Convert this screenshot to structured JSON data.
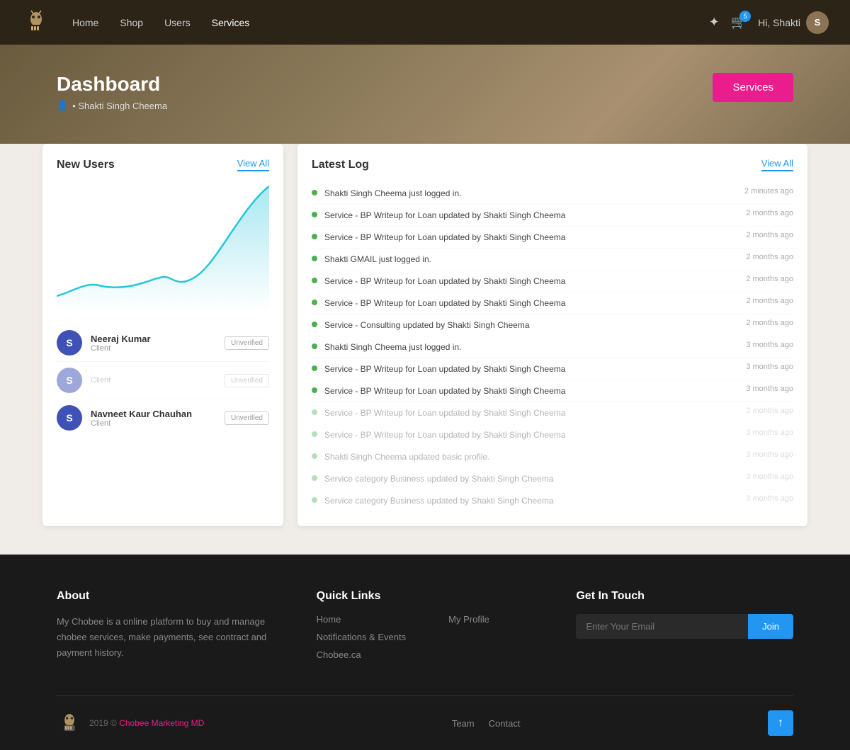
{
  "nav": {
    "links": [
      {
        "label": "Home",
        "active": false
      },
      {
        "label": "Shop",
        "active": false
      },
      {
        "label": "Users",
        "active": false
      },
      {
        "label": "Services",
        "active": true
      }
    ],
    "cart_badge": "5",
    "user_greeting": "Hi, Shakti",
    "avatar_letter": "S"
  },
  "hero": {
    "title": "Dashboard",
    "user": "• Shakti Singh Cheema",
    "services_button": "Services"
  },
  "new_users": {
    "title": "New Users",
    "view_all": "View All",
    "users": [
      {
        "initial": "S",
        "name": "Neeraj Kumar",
        "role": "Client",
        "badge": "Unverified"
      },
      {
        "initial": "S",
        "name": "",
        "role": "Client",
        "badge": "Unverified"
      },
      {
        "initial": "S",
        "name": "Navneet Kaur Chauhan",
        "role": "Client",
        "badge": "Unverified"
      }
    ]
  },
  "latest_log": {
    "title": "Latest Log",
    "view_all": "View All",
    "entries": [
      {
        "text": "Shakti Singh Cheema just logged in.",
        "time": "2 minutes ago"
      },
      {
        "text": "Service - BP Writeup for Loan updated by Shakti Singh Cheema",
        "time": "2 months ago"
      },
      {
        "text": "Service - BP Writeup for Loan updated by Shakti Singh Cheema",
        "time": "2 months ago"
      },
      {
        "text": "Shakti GMAIL just logged in.",
        "time": "2 months ago"
      },
      {
        "text": "Service - BP Writeup for Loan updated by Shakti Singh Cheema",
        "time": "2 months ago"
      },
      {
        "text": "Service - BP Writeup for Loan updated by Shakti Singh Cheema",
        "time": "2 months ago"
      },
      {
        "text": "Service - Consulting updated by Shakti Singh Cheema",
        "time": "2 months ago"
      },
      {
        "text": "Shakti Singh Cheema just logged in.",
        "time": "3 months ago"
      },
      {
        "text": "Service - BP Writeup for Loan updated by Shakti Singh Cheema",
        "time": "3 months ago"
      },
      {
        "text": "Service - BP Writeup for Loan updated by Shakti Singh Cheema",
        "time": "3 months ago"
      },
      {
        "text": "Service - BP Writeup for Loan updated by Shakti Singh Cheema",
        "time": "3 months ago"
      },
      {
        "text": "Service - BP Writeup for Loan updated by Shakti Singh Cheema",
        "time": "3 months ago"
      },
      {
        "text": "Shakti Singh Cheema updated basic profile.",
        "time": "3 months ago"
      },
      {
        "text": "Service category Business updated by Shakti Singh Cheema",
        "time": "3 months ago"
      },
      {
        "text": "Service category Business updated by Shakti Singh Cheema",
        "time": "3 months ago"
      }
    ]
  },
  "footer": {
    "about": {
      "title": "About",
      "text": "My Chobee is a online platform to buy and manage chobee services, make payments, see contract and payment history."
    },
    "quick_links": {
      "title": "Quick Links",
      "col1": [
        "Home",
        "Notifications & Events",
        "Chobee.ca"
      ],
      "col2": [
        "My Profile"
      ]
    },
    "get_in_touch": {
      "title": "Get In Touch",
      "placeholder": "Enter Your Email",
      "join_button": "Join"
    },
    "bottom": {
      "year": "2019 ©",
      "brand": "Chobee Marketing MD",
      "links": [
        "Team",
        "Contact"
      ]
    }
  }
}
